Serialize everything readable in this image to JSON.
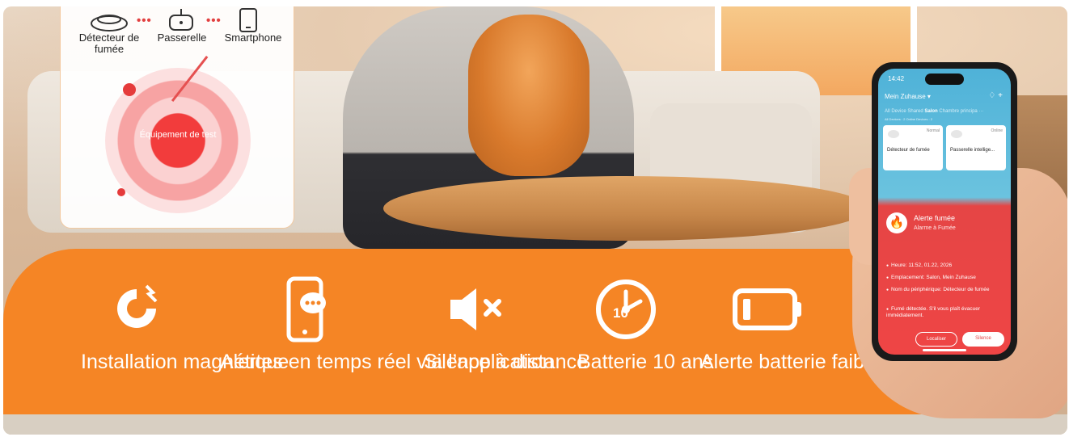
{
  "diagram": {
    "devices": [
      {
        "label": "Détecteur de fumée",
        "icon": "smoke-detector-icon"
      },
      {
        "label": "Passerelle",
        "icon": "gateway-icon"
      },
      {
        "label": "Smartphone",
        "icon": "smartphone-icon"
      }
    ],
    "test_button_label": "Équipement de test"
  },
  "features": [
    {
      "label": "Installation magnétique",
      "icon": "magnet-icon"
    },
    {
      "label": "Alertes en temps réel via l’application",
      "icon": "phone-chat-icon"
    },
    {
      "label": "Silence à distance",
      "icon": "speaker-mute-icon"
    },
    {
      "label": "Batterie 10 ans",
      "icon": "clock-10-icon",
      "icon_text": "10"
    },
    {
      "label": "Alerte batterie faible",
      "icon": "battery-low-icon"
    }
  ],
  "phone": {
    "time": "14:42",
    "home_name": "Mein Zuhause ▾",
    "tabs": [
      "All Device",
      "Shared",
      "Salon",
      "Chambre principa",
      "···"
    ],
    "active_tab": "Salon",
    "counts": "All Devices : 2     Online Devices : 2",
    "devices": [
      {
        "name": "Détecteur de fumée",
        "status": "Normal"
      },
      {
        "name": "Passerelle intellige...",
        "status": "Online"
      }
    ],
    "alert": {
      "title": "Alerte fumée",
      "subtitle": "Alarme à Fumée",
      "info": [
        "Heure: 11:52, 01.22, 2026",
        "Emplacement: Salon, Mein Zuhause",
        "Nom du périphérique: Détecteur de fumée",
        "Fumé détectée. S'il vous plaît évacuer immédiatement."
      ],
      "locate_button": "Localiser",
      "silence_button": "Silence"
    }
  },
  "colors": {
    "orange": "#f58525",
    "alert_red": "#ef4545",
    "app_blue": "#4fb2d8"
  }
}
